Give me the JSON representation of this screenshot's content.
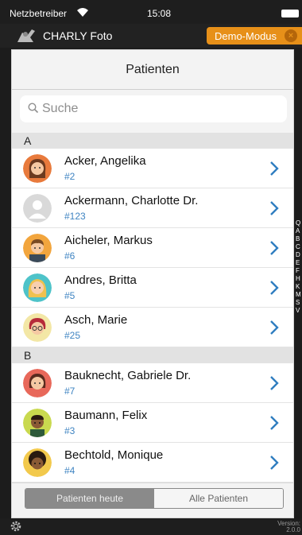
{
  "status_bar": {
    "carrier": "Netzbetreiber",
    "time": "15:08"
  },
  "app_bar": {
    "title": "CHARLY Foto",
    "demo_label": "Demo-Modus"
  },
  "panel": {
    "title": "Patienten",
    "search": {
      "placeholder": "Suche"
    }
  },
  "sections": [
    {
      "letter": "A",
      "patients": [
        {
          "name": "Acker, Angelika",
          "id": "#2",
          "avatar": "woman-brown-hair"
        },
        {
          "name": "Ackermann, Charlotte Dr.",
          "id": "#123",
          "avatar": "placeholder"
        },
        {
          "name": "Aicheler, Markus",
          "id": "#6",
          "avatar": "man-brown-hair"
        },
        {
          "name": "Andres, Britta",
          "id": "#5",
          "avatar": "woman-blonde"
        },
        {
          "name": "Asch, Marie",
          "id": "#25",
          "avatar": "girl-glasses"
        }
      ]
    },
    {
      "letter": "B",
      "patients": [
        {
          "name": "Bauknecht, Gabriele Dr.",
          "id": "#7",
          "avatar": "woman-dark-hair"
        },
        {
          "name": "Baumann, Felix",
          "id": "#3",
          "avatar": "man-dark-skin"
        },
        {
          "name": "Bechtold, Monique",
          "id": "#4",
          "avatar": "woman-curly-hair"
        }
      ]
    }
  ],
  "index_letters": [
    "Q",
    "A",
    "B",
    "C",
    "D",
    "E",
    "F",
    "H",
    "K",
    "M",
    "S",
    "V"
  ],
  "segments": {
    "today": "Patienten heute",
    "all": "Alle Patienten",
    "selected": "today"
  },
  "footer": {
    "version_label": "Version:",
    "version_value": "2.0.0"
  },
  "colors": {
    "accent": "#e79019",
    "id_blue": "#3f84c2",
    "chevron": "#2f7dc0"
  }
}
